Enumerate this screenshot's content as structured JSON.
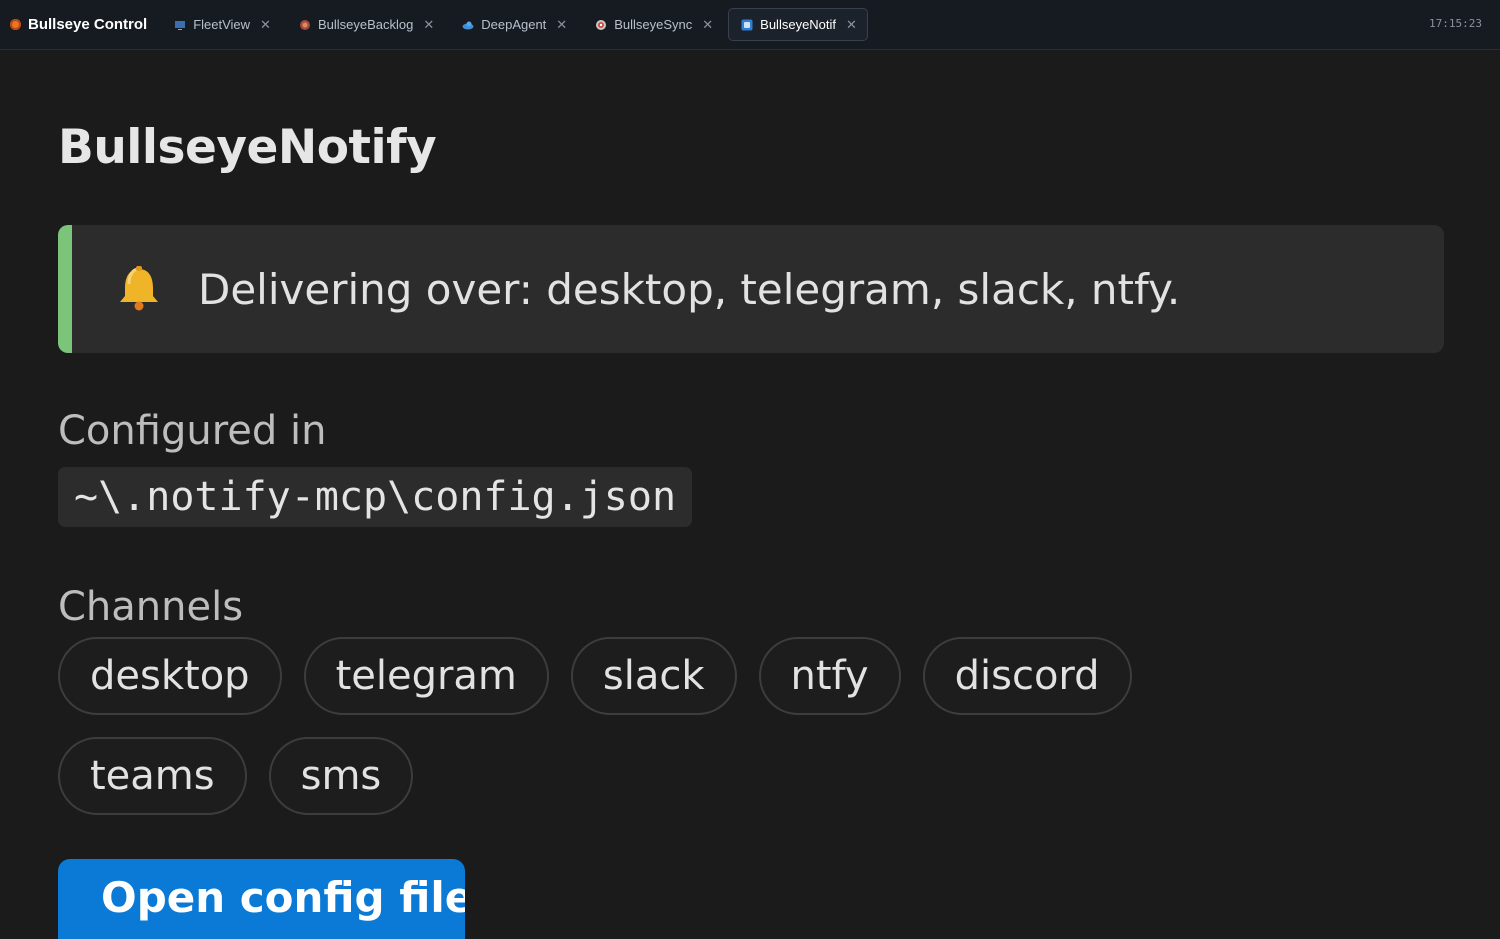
{
  "app": {
    "title": "Bullseye Control",
    "clock": "17:15:23"
  },
  "tabs": [
    {
      "label": "FleetView",
      "icon": "monitor-icon",
      "active": false
    },
    {
      "label": "BullseyeBacklog",
      "icon": "backlog-icon",
      "active": false
    },
    {
      "label": "DeepAgent",
      "icon": "cloud-icon",
      "active": false
    },
    {
      "label": "BullseyeSync",
      "icon": "sync-icon",
      "active": false
    },
    {
      "label": "BullseyeNotif",
      "icon": "notify-icon",
      "active": true
    }
  ],
  "page": {
    "title": "BullseyeNotify",
    "banner": {
      "icon": "bell-icon",
      "text": "Delivering over: desktop, telegram, slack, ntfy.",
      "accent": "#7cc47a"
    },
    "config": {
      "label": "Configured in",
      "path": "~\\.notify-mcp\\config.json"
    },
    "channels": {
      "label": "Channels",
      "items": [
        "desktop",
        "telegram",
        "slack",
        "ntfy",
        "discord",
        "teams",
        "sms"
      ]
    },
    "open_button": {
      "label": "Open config file",
      "color": "#0a7ad6"
    }
  }
}
